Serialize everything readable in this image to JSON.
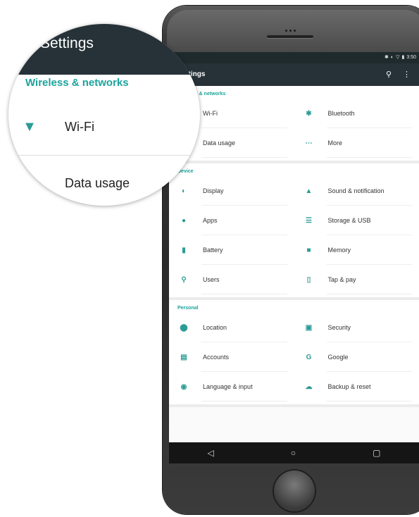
{
  "status_bar": {
    "time": "3:50",
    "icons": [
      "bluetooth-icon",
      "signal-icon",
      "wifi-icon",
      "battery-icon"
    ]
  },
  "app_bar": {
    "title": "Settings",
    "search_icon": "search-icon",
    "menu_icon": "overflow-icon"
  },
  "sections": [
    {
      "title": "Wireless & networks",
      "items": [
        {
          "label": "Wi-Fi",
          "icon": "wifi-icon",
          "glyph": "▼"
        },
        {
          "label": "Bluetooth",
          "icon": "bluetooth-icon",
          "glyph": "✱"
        },
        {
          "label": "Data usage",
          "icon": "data-usage-icon",
          "glyph": "◔"
        },
        {
          "label": "More",
          "icon": "more-icon",
          "glyph": "⋯"
        }
      ]
    },
    {
      "title": "Device",
      "items": [
        {
          "label": "Display",
          "icon": "display-icon",
          "glyph": "◐"
        },
        {
          "label": "Sound & notification",
          "icon": "bell-icon",
          "glyph": "▲"
        },
        {
          "label": "Apps",
          "icon": "android-icon",
          "glyph": "●"
        },
        {
          "label": "Storage & USB",
          "icon": "storage-icon",
          "glyph": "☰"
        },
        {
          "label": "Battery",
          "icon": "battery-icon",
          "glyph": "▮"
        },
        {
          "label": "Memory",
          "icon": "memory-icon",
          "glyph": "■"
        },
        {
          "label": "Users",
          "icon": "user-icon",
          "glyph": "⚲"
        },
        {
          "label": "Tap & pay",
          "icon": "tap-pay-icon",
          "glyph": "▯"
        }
      ]
    },
    {
      "title": "Personal",
      "items": [
        {
          "label": "Location",
          "icon": "location-icon",
          "glyph": "⬤"
        },
        {
          "label": "Security",
          "icon": "lock-icon",
          "glyph": "▣"
        },
        {
          "label": "Accounts",
          "icon": "accounts-icon",
          "glyph": "▤"
        },
        {
          "label": "Google",
          "icon": "google-icon",
          "glyph": "G"
        },
        {
          "label": "Language & input",
          "icon": "globe-icon",
          "glyph": "◉"
        },
        {
          "label": "Backup & reset",
          "icon": "cloud-icon",
          "glyph": "☁"
        }
      ]
    }
  ],
  "magnifier": {
    "title": "Settings",
    "section": "Wireless & networks",
    "items": [
      {
        "label": "Wi-Fi",
        "icon": "wifi-icon",
        "glyph": "▼"
      },
      {
        "label": "Data usage",
        "icon": "data-usage-icon",
        "glyph": "◔"
      }
    ]
  },
  "nav_bar": {
    "back": "◁",
    "home": "○",
    "recents": "▢"
  },
  "colors": {
    "accent": "#1ba39c",
    "app_bar": "#263238",
    "status_bar": "#1e2a2c"
  }
}
